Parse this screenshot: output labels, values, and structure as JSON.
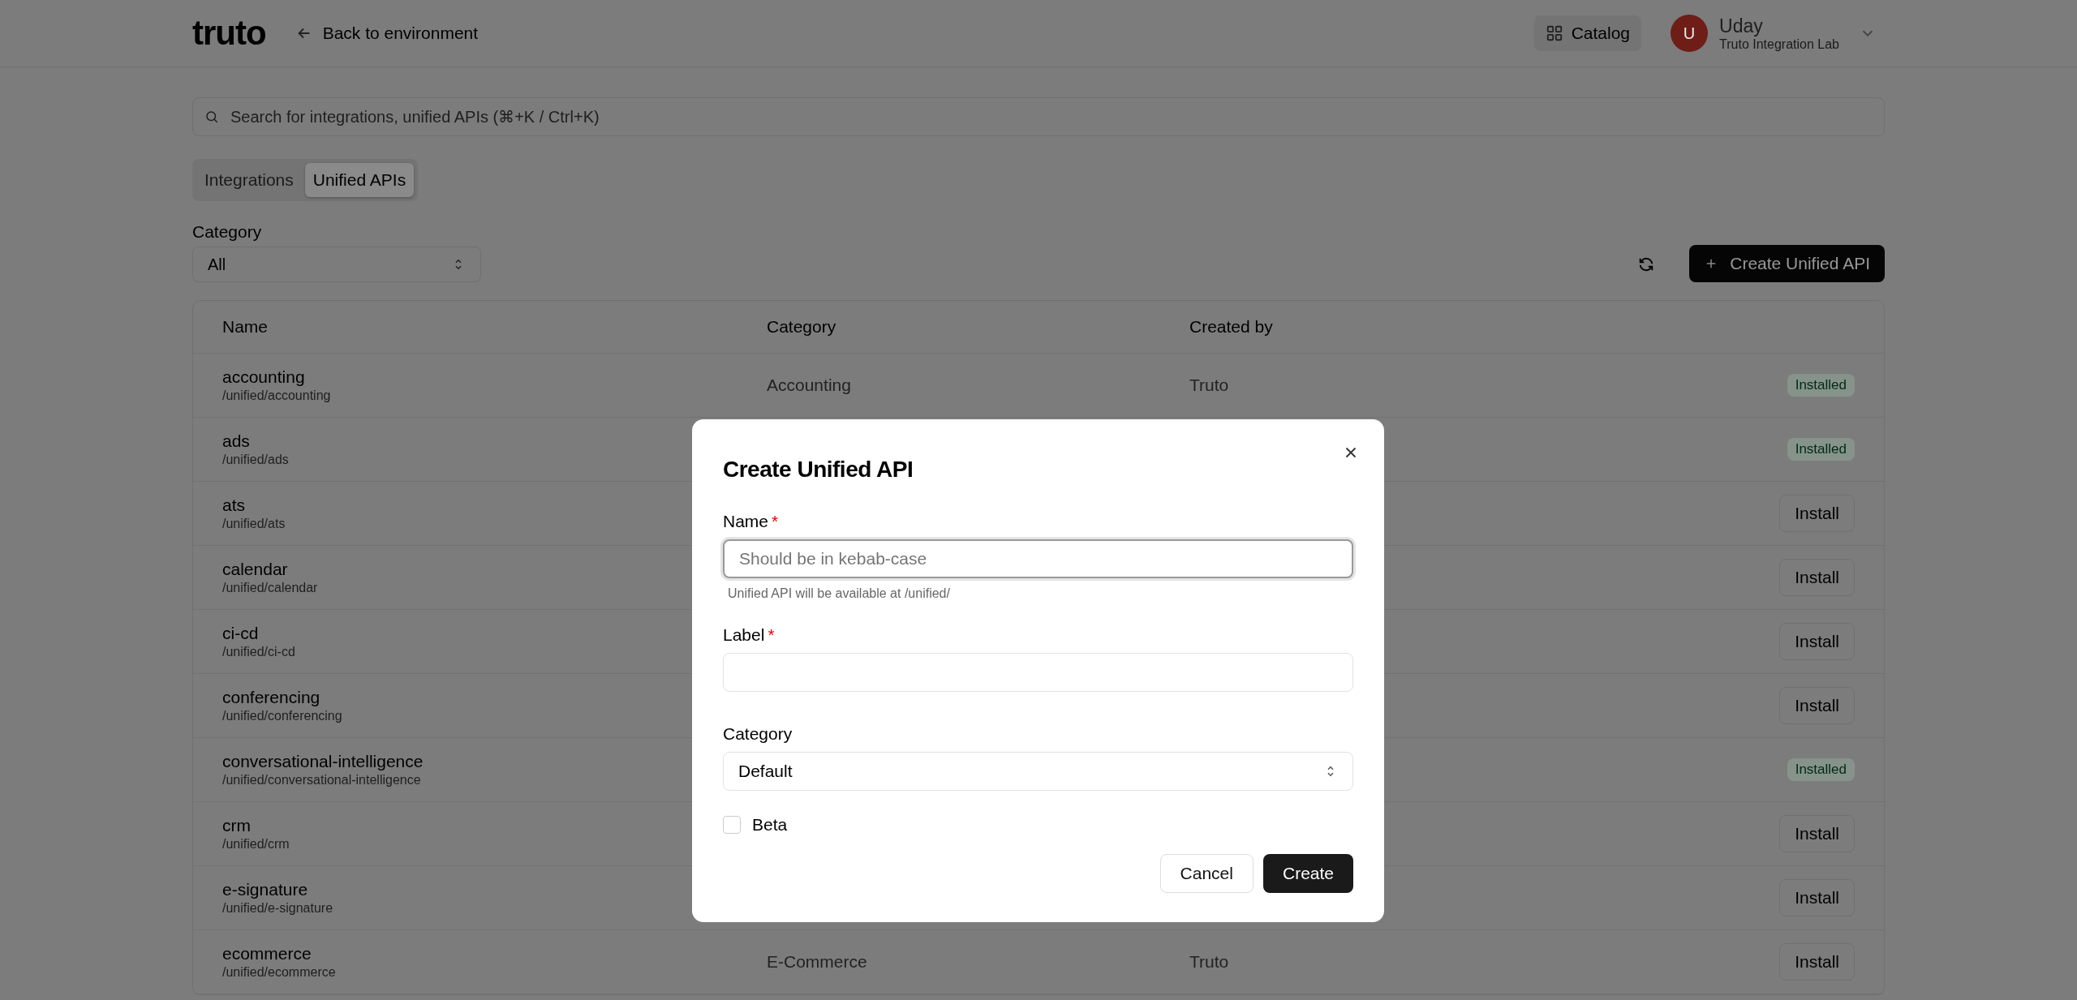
{
  "header": {
    "logo": "truto",
    "back_link": "Back to environment",
    "catalog_button": "Catalog",
    "user": {
      "initial": "U",
      "name": "Uday",
      "org": "Truto Integration Lab"
    }
  },
  "search": {
    "placeholder": "Search for integrations, unified APIs (⌘+K / Ctrl+K)"
  },
  "tabs": [
    {
      "label": "Integrations",
      "selected": false
    },
    {
      "label": "Unified APIs",
      "selected": true
    }
  ],
  "filter": {
    "label": "Category",
    "value": "All"
  },
  "create_button": "Create Unified API",
  "table": {
    "columns": [
      "Name",
      "Category",
      "Created by"
    ],
    "rows": [
      {
        "name": "accounting",
        "path": "/unified/accounting",
        "category": "Accounting",
        "created_by": "Truto",
        "status": "Installed",
        "kind": "installed"
      },
      {
        "name": "ads",
        "path": "/unified/ads",
        "status": "Installed",
        "kind": "installed"
      },
      {
        "name": "ats",
        "path": "/unified/ats",
        "status": "Install",
        "kind": "install"
      },
      {
        "name": "calendar",
        "path": "/unified/calendar",
        "status": "Install",
        "kind": "install"
      },
      {
        "name": "ci-cd",
        "path": "/unified/ci-cd",
        "status": "Install",
        "kind": "install"
      },
      {
        "name": "conferencing",
        "path": "/unified/conferencing",
        "status": "Install",
        "kind": "install"
      },
      {
        "name": "conversational-intelligence",
        "path": "/unified/conversational-intelligence",
        "status": "Installed",
        "kind": "installed"
      },
      {
        "name": "crm",
        "path": "/unified/crm",
        "status": "Install",
        "kind": "install"
      },
      {
        "name": "e-signature",
        "path": "/unified/e-signature",
        "status": "Install",
        "kind": "install"
      },
      {
        "name": "ecommerce",
        "path": "/unified/ecommerce",
        "category": "E-Commerce",
        "created_by": "Truto",
        "status": "Install",
        "kind": "install"
      }
    ]
  },
  "dialog": {
    "title": "Create Unified API",
    "name_field": {
      "label": "Name",
      "required_mark": "*",
      "placeholder": "Should be in kebab-case",
      "hint": "Unified API will be available at /unified/"
    },
    "label_field": {
      "label": "Label",
      "required_mark": "*"
    },
    "category_field": {
      "label": "Category",
      "value": "Default"
    },
    "beta": {
      "label": "Beta",
      "checked": false
    },
    "buttons": [
      "Cancel",
      "Create"
    ]
  }
}
